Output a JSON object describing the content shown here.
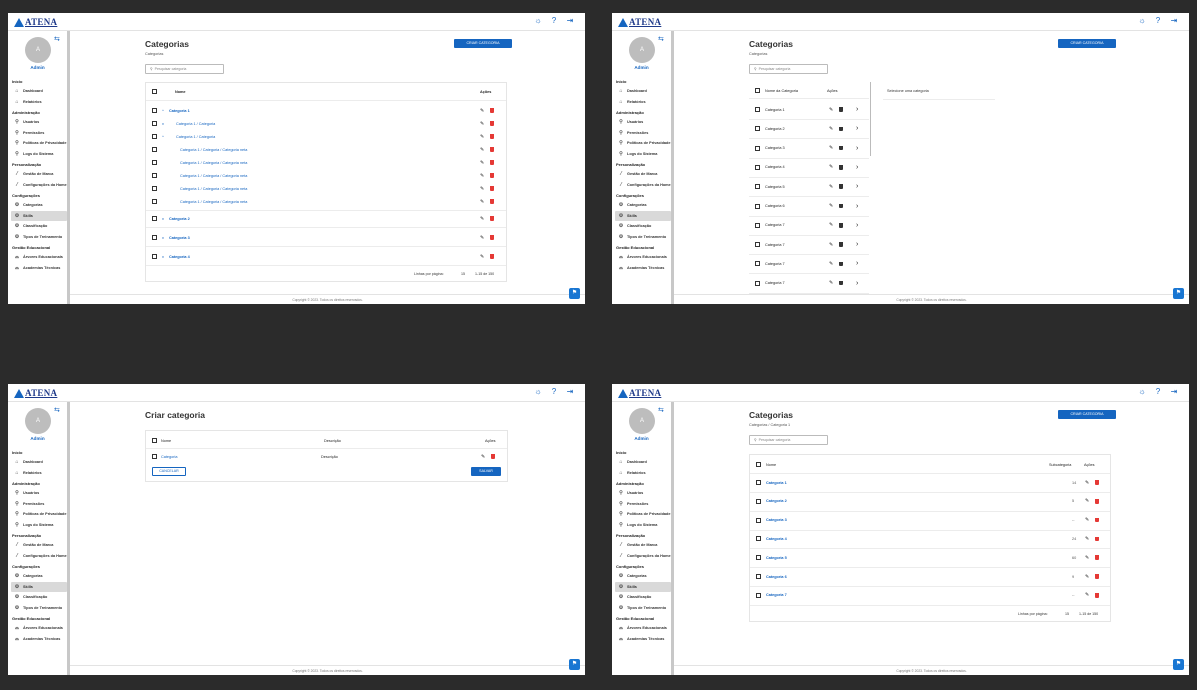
{
  "app": {
    "logo_text": "ATENA"
  },
  "topbar": {
    "icons": [
      "sun-icon",
      "help-icon",
      "logout-icon"
    ],
    "icon_glyphs": [
      "☼",
      "?",
      "⇥"
    ]
  },
  "sidebar": {
    "avatar_letter": "A",
    "user_name": "Admin",
    "sections": [
      {
        "title": "Início",
        "items": [
          {
            "label": "Dashboard",
            "icon": "home-icon",
            "glyph": "⌂"
          },
          {
            "label": "Relatórios",
            "icon": "home-icon",
            "glyph": "⌂"
          }
        ]
      },
      {
        "title": "Administração",
        "items": [
          {
            "label": "Usuários",
            "icon": "key-icon",
            "glyph": "⚲"
          },
          {
            "label": "Permissões",
            "icon": "key-icon",
            "glyph": "⚲"
          },
          {
            "label": "Políticas de Privacidade",
            "icon": "key-icon",
            "glyph": "⚲"
          },
          {
            "label": "Logs do Sistema",
            "icon": "key-icon",
            "glyph": "⚲"
          }
        ]
      },
      {
        "title": "Personalização",
        "items": [
          {
            "label": "Gestão de Marca",
            "icon": "pen-icon",
            "glyph": "⁄"
          },
          {
            "label": "Configurações da Home",
            "icon": "pen-icon",
            "glyph": "⁄"
          }
        ]
      },
      {
        "title": "Configurações",
        "items": [
          {
            "label": "Categorias",
            "icon": "gear-icon",
            "glyph": "⚙"
          },
          {
            "label": "Skills",
            "icon": "gear-icon",
            "glyph": "⚙",
            "active": true
          },
          {
            "label": "Classificação",
            "icon": "gear-icon",
            "glyph": "⚙"
          },
          {
            "label": "Tipos de Treinamento",
            "icon": "gear-icon",
            "glyph": "⚙"
          }
        ]
      },
      {
        "title": "Gestão Educacional",
        "items": [
          {
            "label": "Árvores Educacionais",
            "icon": "graduation-icon",
            "glyph": "⌓"
          },
          {
            "label": "Academias Técnicas",
            "icon": "graduation-icon",
            "glyph": "⌓"
          }
        ]
      }
    ]
  },
  "footer": {
    "copyright": "Copyright © 2023. Todos os direitos reservados."
  },
  "panel1": {
    "title": "Categorias",
    "breadcrumb": "Categorias",
    "create_button": "CRIAR CATEGORIA",
    "search_placeholder": "Pesquisar categoria",
    "col_name": "Nome",
    "col_actions": "Ações",
    "rows": [
      {
        "label": "Categoria 1",
        "level": 0,
        "chev": "^",
        "bold": true
      },
      {
        "label": "Categoria 1 / Categoria",
        "level": 1,
        "chev": "v"
      },
      {
        "label": "Categoria 1 / Categoria",
        "level": 1,
        "chev": "^"
      },
      {
        "label": "Categoria 1 / Categoria / Categoria neta",
        "level": 2,
        "chev": ""
      },
      {
        "label": "Categoria 1 / Categoria / Categoria neta",
        "level": 2,
        "chev": ""
      },
      {
        "label": "Categoria 1 / Categoria / Categoria neta",
        "level": 2,
        "chev": ""
      },
      {
        "label": "Categoria 1 / Categoria / Categoria neta",
        "level": 2,
        "chev": ""
      },
      {
        "label": "Categoria 1 / Categoria / Categoria neta",
        "level": 2,
        "chev": ""
      },
      {
        "label": "Categoria 2",
        "level": 0,
        "chev": "v",
        "bold": true
      },
      {
        "label": "Categoria 3",
        "level": 0,
        "chev": "v",
        "bold": true
      },
      {
        "label": "Categoria 4",
        "level": 0,
        "chev": "v",
        "bold": true
      }
    ],
    "rows_per_page_label": "Linhas por página:",
    "rows_per_page": "15",
    "range": "1-15 de 150"
  },
  "panel2": {
    "title": "Categorias",
    "breadcrumb": "Categorias",
    "create_button": "CRIAR CATEGORIA",
    "search_placeholder": "Pesquisar categoria",
    "col_name": "Nome da Categoria",
    "col_actions": "Ações",
    "detail_placeholder": "Selecione uma categoria",
    "rows": [
      "Categoria 1",
      "Categoria 2",
      "Categoria 3",
      "Categoria 4",
      "Categoria 5",
      "Categoria 6",
      "Categoria 7",
      "Categoria 7",
      "Categoria 7",
      "Categoria 7"
    ]
  },
  "panel3": {
    "title": "Criar categoria",
    "col_name": "Nome",
    "col_desc": "Descrição",
    "col_actions": "Ações",
    "row_name": "Categoria",
    "row_desc": "Descrição",
    "cancel": "CANCELAR",
    "save": "SALVAR"
  },
  "panel4": {
    "title": "Categorias",
    "breadcrumb": "Categorias / Categoria 1",
    "create_button": "CRIAR CATEGORIA",
    "search_placeholder": "Pesquisar categoria",
    "col_name": "Nome",
    "col_sub": "Subcategoria",
    "col_actions": "Ações",
    "rows": [
      {
        "label": "Categoria 1",
        "sub": "14"
      },
      {
        "label": "Categoria 2",
        "sub": "5"
      },
      {
        "label": "Categoria 3",
        "sub": "--"
      },
      {
        "label": "Categoria 4",
        "sub": "24"
      },
      {
        "label": "Categoria 5",
        "sub": "60"
      },
      {
        "label": "Categoria 6",
        "sub": "9"
      },
      {
        "label": "Categoria 7",
        "sub": "--"
      }
    ],
    "rows_per_page_label": "Linhas por página:",
    "rows_per_page": "15",
    "range": "1-15 de 150"
  }
}
